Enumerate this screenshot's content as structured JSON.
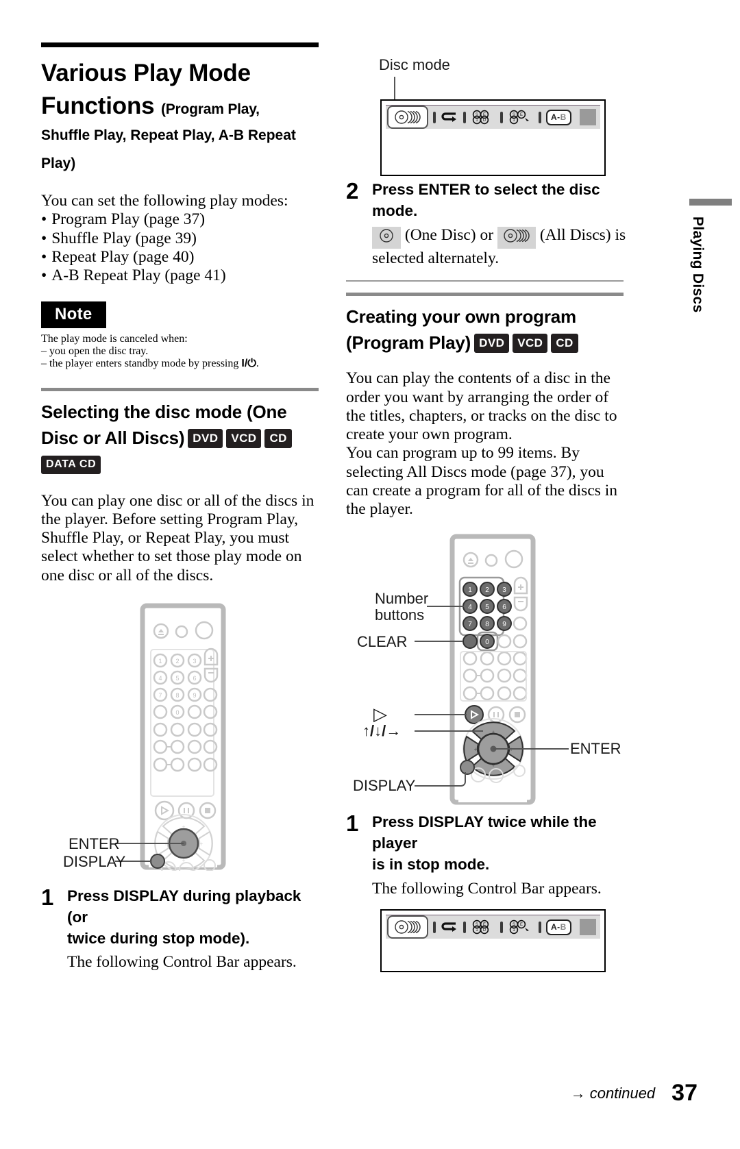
{
  "page": {
    "number": "37",
    "continued_label": "continued",
    "continued_arrow": "→",
    "side_tab_label": "Playing Discs"
  },
  "left": {
    "title_main": "Various Play Mode",
    "title_second": "Functions",
    "title_paren1": "(Program Play,",
    "title_paren2": "Shuffle Play, Repeat Play, A-B Repeat",
    "title_paren3": "Play)",
    "intro": "You can set the following play modes:",
    "modes": [
      "Program Play (page 37)",
      "Shuffle Play (page 39)",
      "Repeat Play (page 40)",
      "A-B Repeat Play (page 41)"
    ],
    "note": {
      "badge": "Note",
      "line1": "The play mode is canceled when:",
      "line2": "– you open the disc tray.",
      "line3_pre": "– the player enters standby mode by pressing ",
      "line3_symbol": "I/⏻",
      "line3_post": "."
    },
    "section2": {
      "heading_line1": "Selecting the disc mode (One",
      "heading_line2": "Disc or All Discs)",
      "badges": [
        "DVD",
        "VCD",
        "CD"
      ],
      "badge_data": "DATA CD",
      "body": "You can play one disc or all of the discs in the player. Before setting Program Play, Shuffle Play, or Repeat Play, you must select whether to set those play mode on one disc or all of the discs."
    },
    "remote_callouts": {
      "enter": "ENTER",
      "display": "DISPLAY"
    },
    "step1": {
      "num": "1",
      "title_line1": "Press DISPLAY during playback (or",
      "title_line2": "twice during stop mode).",
      "body": "The following Control Bar appears."
    }
  },
  "right": {
    "disc_mode_callout": "Disc mode",
    "step2": {
      "num": "2",
      "title": "Press ENTER to select the disc mode.",
      "body_one_disc": "(One Disc) or",
      "body_all_discs": "(All Discs) is",
      "body_line2": "selected alternately."
    },
    "section3": {
      "heading_line1": "Creating your own program",
      "heading_line2": "(Program Play)",
      "badges": [
        "DVD",
        "VCD",
        "CD"
      ],
      "body_p1": "You can play the contents of a disc in the order you want by arranging the order of the titles, chapters, or tracks on the disc to create your own program.",
      "body_p2": "You can program up to 99 items. By selecting All Discs mode (page 37), you can create a program for all of the discs in the player."
    },
    "remote_callouts": {
      "number_buttons_line1": "Number",
      "number_buttons_line2": "buttons",
      "clear": "CLEAR",
      "play": "▷",
      "arrows": "↑/↓/→",
      "enter": "ENTER",
      "display": "DISPLAY"
    },
    "step1": {
      "num": "1",
      "title_line1": "Press DISPLAY twice while the player",
      "title_line2": "is in stop mode.",
      "body": "The following Control Bar appears."
    }
  },
  "control_bar": {
    "ab_label_a": "A-",
    "ab_label_b": "B"
  },
  "remote_keypad": {
    "row1": [
      "1",
      "2",
      "3"
    ],
    "row2": [
      "4",
      "5",
      "6"
    ],
    "row3": [
      "7",
      "8",
      "9"
    ],
    "row4": [
      "0"
    ],
    "plus": "+",
    "minus": "−"
  },
  "colors": {
    "rule_black": "#000000",
    "rule_gray": "#8a8a8a",
    "badge_bg": "#231f20",
    "remote_body": "#b9b9b9",
    "button_outline": "#c9c9c9",
    "highlight_button": "#6d6d6d",
    "control_bar_bg": "#dcdcdc",
    "control_bar_top": "#6e5a6e"
  }
}
